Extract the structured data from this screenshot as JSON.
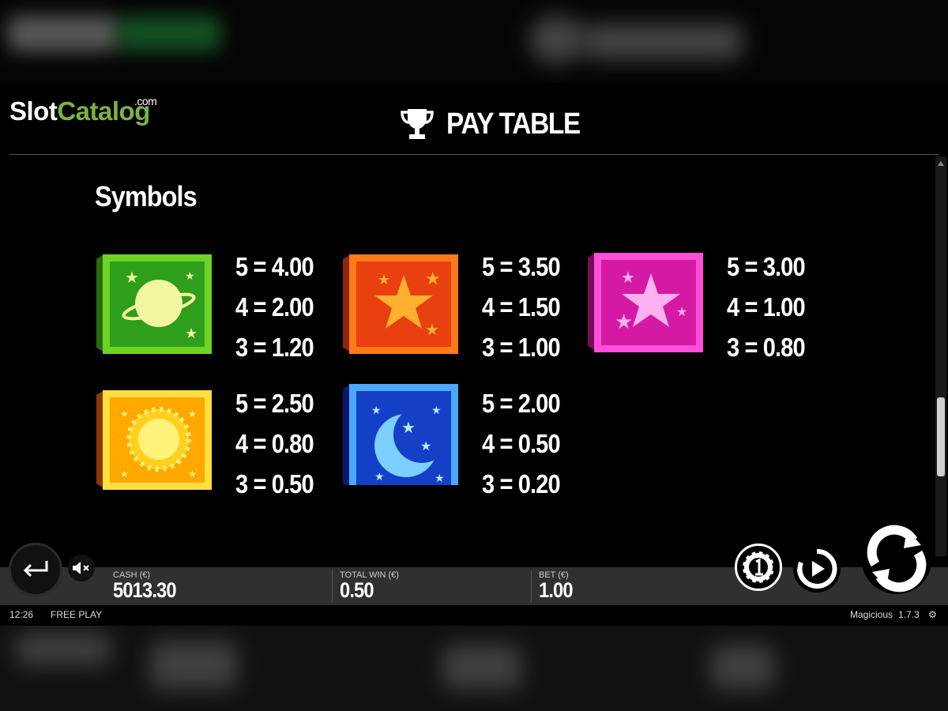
{
  "logo": {
    "part1": "Slot",
    "part2": "Catalog",
    "suffix": ".com"
  },
  "header": {
    "title": "PAY TABLE",
    "icon": "trophy-icon"
  },
  "section": {
    "title": "Symbols"
  },
  "symbols": [
    {
      "name": "green-planet-symbol",
      "color": "#4caf20",
      "pays": [
        "5 = 4.00",
        "4 = 2.00",
        "3 = 1.20"
      ]
    },
    {
      "name": "orange-star-symbol",
      "color": "#f0501a",
      "pays": [
        "5 = 3.50",
        "4 = 1.50",
        "3 = 1.00"
      ]
    },
    {
      "name": "pink-star-symbol",
      "color": "#e020b0",
      "pays": [
        "5 = 3.00",
        "4 = 1.00",
        "3 = 0.80"
      ]
    },
    {
      "name": "yellow-sun-symbol",
      "color": "#ffb800",
      "pays": [
        "5 = 2.50",
        "4 = 0.80",
        "3 = 0.50"
      ]
    },
    {
      "name": "blue-moon-symbol",
      "color": "#1040d0",
      "pays": [
        "5 = 2.00",
        "4 = 0.50",
        "3 = 0.20"
      ]
    }
  ],
  "bottom_bar": {
    "cash": {
      "label": "CASH (€)",
      "value": "5013.30"
    },
    "total_win": {
      "label": "TOTAL WIN (€)",
      "value": "0.50"
    },
    "bet": {
      "label": "BET (€)",
      "value": "1.00"
    }
  },
  "status_bar": {
    "time": "12:26",
    "mode": "FREE PLAY",
    "game_name": "Magicious",
    "version": "1.7.3"
  },
  "buttons": {
    "back": "back-arrow-icon",
    "sound": "sound-muted-icon",
    "coin": "coin-value-icon",
    "autoplay": "autoplay-icon",
    "spin": "spin-icon"
  }
}
